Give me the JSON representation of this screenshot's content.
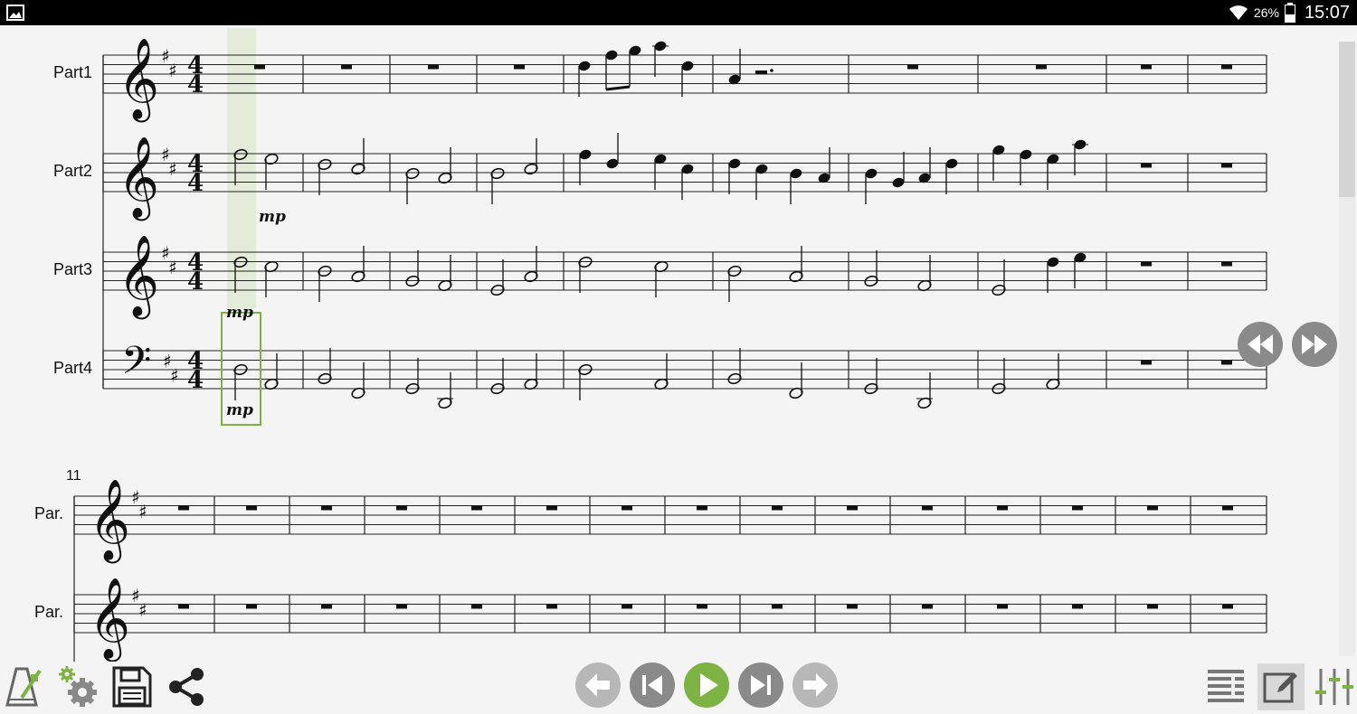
{
  "status_bar": {
    "battery_percent": "26%",
    "clock": "15:07",
    "icons": [
      "gallery-icon",
      "wifi-icon",
      "battery-icon"
    ]
  },
  "score": {
    "system1": {
      "parts": [
        "Part1",
        "Part2",
        "Part3",
        "Part4"
      ],
      "time_signature": "4/4",
      "key_signature": "D major (2 sharps)",
      "dynamics": [
        "mp",
        "mp",
        "mp"
      ]
    },
    "system2": {
      "measure_number": "11",
      "parts": [
        "Par.",
        "Par."
      ]
    }
  },
  "colors": {
    "accent": "#7cb342",
    "highlight": "#e3ecd9",
    "button_gray": "#8a8a8a",
    "disabled_gray": "#b7b7b7"
  },
  "toolbar": {
    "left_icons": [
      "metronome-icon",
      "settings-icon",
      "save-icon",
      "share-icon"
    ],
    "center_icons": [
      "undo-icon",
      "previous-icon",
      "play-icon",
      "next-icon",
      "redo-icon"
    ],
    "right_icons": [
      "layout-icon",
      "edit-icon",
      "mixer-icon"
    ]
  },
  "navigation": [
    "rewind-icon",
    "fast-forward-icon"
  ]
}
